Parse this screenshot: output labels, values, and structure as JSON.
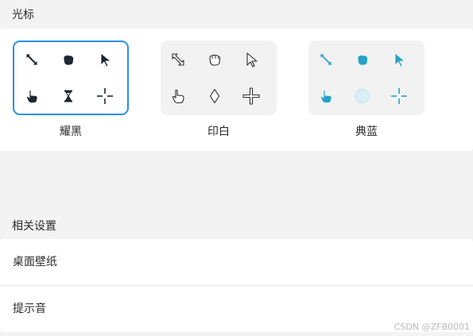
{
  "cursor_section": {
    "title": "光标",
    "themes": [
      {
        "name": "耀黑",
        "selected": true,
        "accent": "#1f2733",
        "icons": [
          "resize-diagonal-icon",
          "grab-hand-icon",
          "arrow-pointer-icon",
          "pointing-hand-icon",
          "hourglass-busy-icon",
          "crosshair-icon"
        ]
      },
      {
        "name": "印白",
        "selected": false,
        "accent": "#ffffff",
        "icons": [
          "resize-diagonal-icon",
          "grab-hand-icon",
          "arrow-pointer-icon",
          "pointing-hand-icon",
          "busy-diamond-icon",
          "crosshair-icon"
        ]
      },
      {
        "name": "典蓝",
        "selected": false,
        "accent": "#2aa1c7",
        "icons": [
          "resize-diagonal-icon",
          "grab-hand-icon",
          "arrow-pointer-icon",
          "pointing-hand-icon",
          "busy-circle-icon",
          "crosshair-icon"
        ]
      }
    ]
  },
  "related_section": {
    "title": "相关设置",
    "items": [
      {
        "label": "桌面壁纸"
      },
      {
        "label": "提示音"
      }
    ]
  },
  "watermark": "CSDN @ZFB0001",
  "colors": {
    "selection_border": "#2c8ef2",
    "background": "#f3f3f3",
    "card": "#ffffff"
  }
}
